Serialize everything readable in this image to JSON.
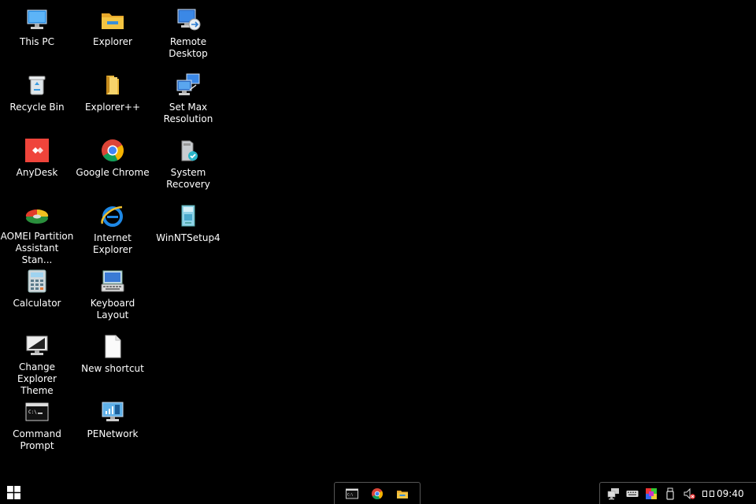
{
  "desktop": {
    "icons": [
      {
        "label": "This PC",
        "icon": "this-pc-icon"
      },
      {
        "label": "Recycle Bin",
        "icon": "recycle-bin-icon"
      },
      {
        "label": "AnyDesk",
        "icon": "anydesk-icon"
      },
      {
        "label": "AOMEI Partition\nAssistant Stan...",
        "icon": "aomei-partition-icon"
      },
      {
        "label": "Calculator",
        "icon": "calculator-icon"
      },
      {
        "label": "Change Explorer\nTheme",
        "icon": "change-theme-icon"
      },
      {
        "label": "Command\nPrompt",
        "icon": "command-prompt-icon"
      },
      {
        "label": "Explorer",
        "icon": "explorer-folder-icon"
      },
      {
        "label": "Explorer++",
        "icon": "explorer-plus-icon"
      },
      {
        "label": "Google Chrome",
        "icon": "chrome-icon"
      },
      {
        "label": "Internet Explorer",
        "icon": "internet-explorer-icon"
      },
      {
        "label": "Keyboard Layout",
        "icon": "keyboard-layout-icon"
      },
      {
        "label": "New shortcut",
        "icon": "new-shortcut-icon"
      },
      {
        "label": "PENetwork",
        "icon": "penetwork-icon"
      },
      {
        "label": "Remote Desktop",
        "icon": "remote-desktop-icon"
      },
      {
        "label": "Set Max\nResolution",
        "icon": "set-resolution-icon"
      },
      {
        "label": "System Recovery",
        "icon": "system-recovery-icon"
      },
      {
        "label": "WinNTSetup4",
        "icon": "winntsetup-icon"
      }
    ]
  },
  "taskbar": {
    "start_icon": "windows-start-icon",
    "pinned": [
      {
        "icon": "command-prompt-icon"
      },
      {
        "icon": "chrome-icon"
      },
      {
        "icon": "explorer-folder-icon"
      }
    ],
    "tray": [
      {
        "icon": "network-icon"
      },
      {
        "icon": "keyboard-icon"
      },
      {
        "icon": "color-display-icon"
      },
      {
        "icon": "usb-drive-icon"
      },
      {
        "icon": "volume-muted-icon"
      }
    ],
    "clock": "09:40"
  },
  "colors": {
    "background": "#000000",
    "anydesk": "#ef443b",
    "folder": "#f4c542"
  }
}
